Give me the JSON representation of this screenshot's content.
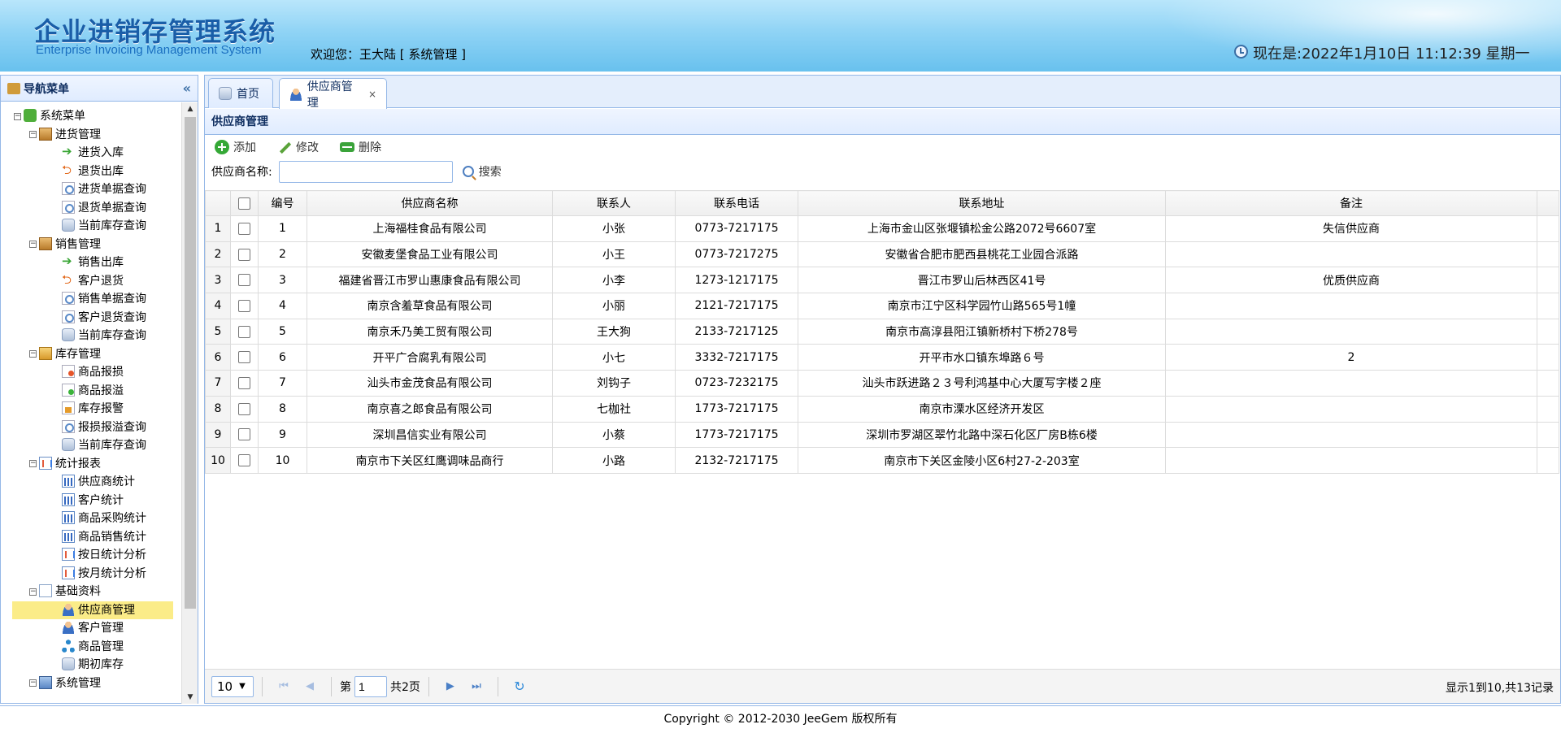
{
  "header": {
    "title": "企业进销存管理系统",
    "subtitle": "Enterprise Invoicing Management System",
    "welcome": "欢迎您：王大陆 [ 系统管理 ]",
    "clock": "现在是:2022年1月10日 11:12:39 星期一"
  },
  "sidebar": {
    "title": "导航菜单",
    "collapse": "«",
    "root": "系统菜单",
    "groups": [
      {
        "label": "进货管理",
        "items": [
          "进货入库",
          "退货出库",
          "进货单据查询",
          "退货单据查询",
          "当前库存查询"
        ]
      },
      {
        "label": "销售管理",
        "items": [
          "销售出库",
          "客户退货",
          "销售单据查询",
          "客户退货查询",
          "当前库存查询"
        ]
      },
      {
        "label": "库存管理",
        "items": [
          "商品报损",
          "商品报溢",
          "库存报警",
          "报损报溢查询",
          "当前库存查询"
        ]
      },
      {
        "label": "统计报表",
        "items": [
          "供应商统计",
          "客户统计",
          "商品采购统计",
          "商品销售统计",
          "按日统计分析",
          "按月统计分析"
        ]
      },
      {
        "label": "基础资料",
        "items": [
          "供应商管理",
          "客户管理",
          "商品管理",
          "期初库存"
        ]
      },
      {
        "label": "系统管理",
        "items": []
      }
    ]
  },
  "tabs": [
    {
      "label": "首页"
    },
    {
      "label": "供应商管理",
      "close": "×"
    }
  ],
  "panel": {
    "title": "供应商管理",
    "toolbar": {
      "add": "添加",
      "edit": "修改",
      "delete": "删除"
    },
    "search": {
      "label": "供应商名称:",
      "value": "",
      "button": "搜索"
    }
  },
  "grid": {
    "columns": [
      "编号",
      "供应商名称",
      "联系人",
      "联系电话",
      "联系地址",
      "备注"
    ],
    "rows": [
      {
        "rn": "1",
        "id": "1",
        "name": "上海福桂食品有限公司",
        "contact": "小张",
        "phone": "0773-7217175",
        "address": "上海市金山区张堰镇松金公路2072号6607室",
        "remark": "失信供应商"
      },
      {
        "rn": "2",
        "id": "2",
        "name": "安徽麦堡食品工业有限公司",
        "contact": "小王",
        "phone": "0773-7217275",
        "address": "安徽省合肥市肥西县桃花工业园合派路",
        "remark": ""
      },
      {
        "rn": "3",
        "id": "3",
        "name": "福建省晋江市罗山惠康食品有限公司",
        "contact": "小李",
        "phone": "1273-1217175",
        "address": "晋江市罗山后林西区41号",
        "remark": "优质供应商"
      },
      {
        "rn": "4",
        "id": "4",
        "name": "南京含羞草食品有限公司",
        "contact": "小丽",
        "phone": "2121-7217175",
        "address": "南京市江宁区科学园竹山路565号1幢",
        "remark": ""
      },
      {
        "rn": "5",
        "id": "5",
        "name": "南京禾乃美工贸有限公司",
        "contact": "王大狗",
        "phone": "2133-7217125",
        "address": "南京市高淳县阳江镇新桥村下桥278号",
        "remark": ""
      },
      {
        "rn": "6",
        "id": "6",
        "name": "开平广合腐乳有限公司",
        "contact": "小七",
        "phone": "3332-7217175",
        "address": "开平市水口镇东埠路６号",
        "remark": "2"
      },
      {
        "rn": "7",
        "id": "7",
        "name": "汕头市金茂食品有限公司",
        "contact": "刘钩子",
        "phone": "0723-7232175",
        "address": "汕头市跃进路２３号利鸿基中心大厦写字楼２座",
        "remark": ""
      },
      {
        "rn": "8",
        "id": "8",
        "name": "南京喜之郎食品有限公司",
        "contact": "七枷社",
        "phone": "1773-7217175",
        "address": "南京市溧水区经济开发区",
        "remark": ""
      },
      {
        "rn": "9",
        "id": "9",
        "name": "深圳昌信实业有限公司",
        "contact": "小蔡",
        "phone": "1773-7217175",
        "address": "深圳市罗湖区翠竹北路中深石化区厂房B栋6楼",
        "remark": ""
      },
      {
        "rn": "10",
        "id": "10",
        "name": "南京市下关区红鹰调味品商行",
        "contact": "小路",
        "phone": "2132-7217175",
        "address": "南京市下关区金陵小区6村27-2-203室",
        "remark": ""
      }
    ]
  },
  "pager": {
    "page_size": "10",
    "page_prefix": "第",
    "page": "1",
    "page_total": "共2页",
    "info": "显示1到10,共13记录"
  },
  "footer": "Copyright © 2012-2030 JeeGem 版权所有"
}
